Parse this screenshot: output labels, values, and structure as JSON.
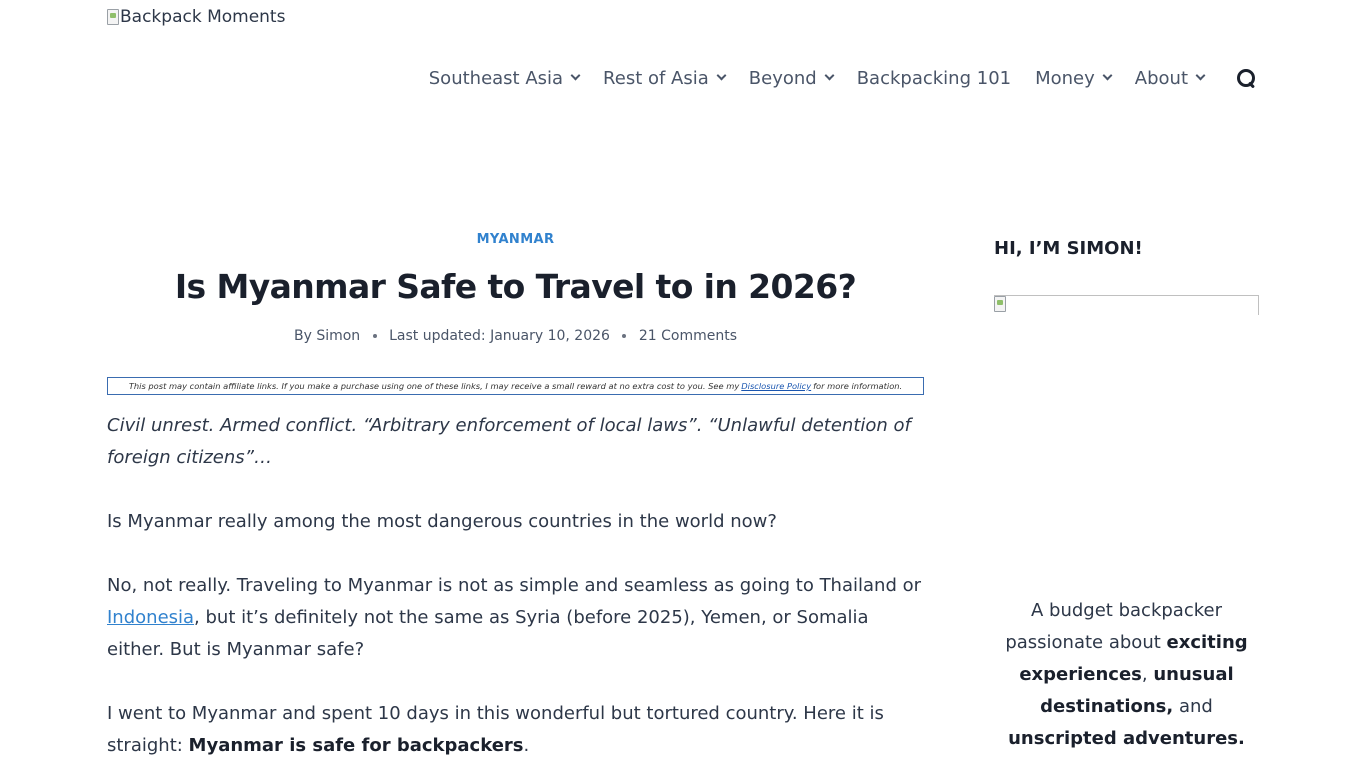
{
  "header": {
    "logo_alt": "Backpack Moments",
    "nav": [
      {
        "label": "Southeast Asia",
        "dropdown": true
      },
      {
        "label": "Rest of Asia",
        "dropdown": true
      },
      {
        "label": "Beyond",
        "dropdown": true
      },
      {
        "label": "Backpacking 101",
        "dropdown": false
      },
      {
        "label": "Money",
        "dropdown": true
      },
      {
        "label": "About",
        "dropdown": true
      }
    ],
    "search_icon": "search-icon"
  },
  "article": {
    "category": "MYANMAR",
    "title": "Is Myanmar Safe to Travel to in 2026?",
    "meta": {
      "by": "By",
      "author": "Simon",
      "updated": "Last updated: January 10, 2026",
      "comments": "21 Comments"
    },
    "disclosure": {
      "text_before": "This post may contain affiliate links. If you make a purchase using one of these links, I may receive a small reward at no extra cost to you. See my",
      "link": "Disclosure Policy",
      "text_after": "for more information."
    },
    "paragraphs": {
      "intro": "Civil unrest. Armed conflict. “Arbitrary enforcement of local laws”. “Unlawful detention of foreign citizens”…",
      "question": "Is Myanmar really among the most dangerous countries in the world now?",
      "answer_before": "No, not really. Traveling to Myanmar is not as simple and seamless as going to Thailand or ",
      "answer_link": "Indonesia",
      "answer_after": ", but it’s definitely not the same as Syria (before 2025), Yemen, or Somalia either. But is Myanmar safe?",
      "trip_before": "I went to Myanmar and spent 10 days in this wonderful but tortured country. Here it is straight: ",
      "trip_bold": "Myanmar is safe for backpackers",
      "trip_after": "."
    }
  },
  "sidebar": {
    "title": "HI, I’M SIMON!",
    "bio": {
      "t1": "A budget backpacker passionate about ",
      "b1": "exciting experiences",
      "t2": ", ",
      "b2": "unusual destinations,",
      "t3": " and ",
      "b3": "unscripted adventures."
    }
  }
}
